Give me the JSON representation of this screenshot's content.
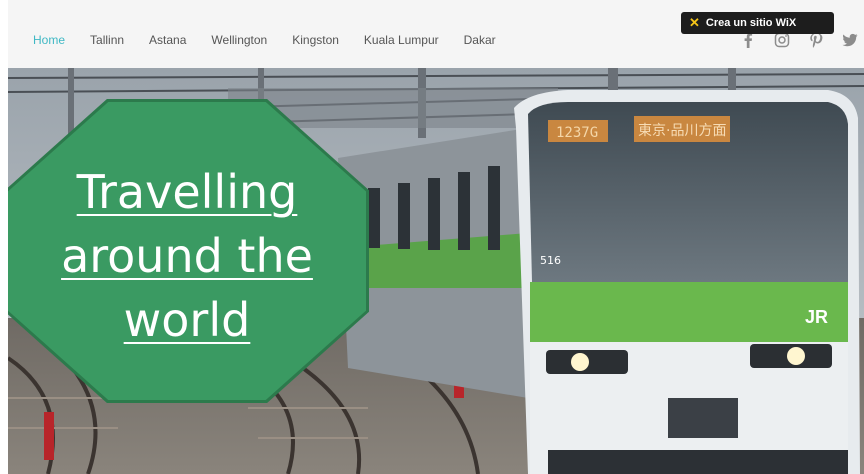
{
  "nav": {
    "items": [
      {
        "label": "Home",
        "active": true
      },
      {
        "label": "Tallinn",
        "active": false
      },
      {
        "label": "Astana",
        "active": false
      },
      {
        "label": "Wellington",
        "active": false
      },
      {
        "label": "Kingston",
        "active": false
      },
      {
        "label": "Kuala Lumpur",
        "active": false
      },
      {
        "label": "Dakar",
        "active": false
      }
    ]
  },
  "wix_banner": {
    "icon": "wix-x-icon",
    "label": "Crea un sitio WiX"
  },
  "social": [
    "facebook-icon",
    "instagram-icon",
    "pinterest-icon",
    "twitter-icon"
  ],
  "hero": {
    "title_lines": [
      "Travelling",
      "around the",
      "world"
    ],
    "train_display_number": "1237G",
    "train_destination": "東京·品川方面",
    "train_side_number": "516",
    "train_logo": "JR",
    "accent_color": "#3a9a62"
  }
}
